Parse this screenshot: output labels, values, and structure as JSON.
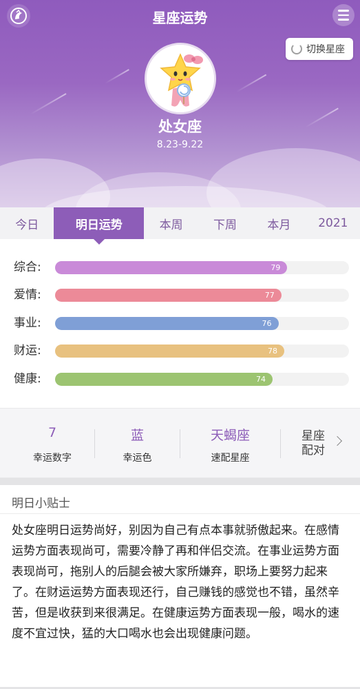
{
  "header": {
    "title": "星座运势",
    "switch_label": "切换星座"
  },
  "sign": {
    "name": "处女座",
    "dates": "8.23-9.22"
  },
  "tabs": [
    {
      "label": "今日",
      "active": false
    },
    {
      "label": "明日运势",
      "active": true
    },
    {
      "label": "本周",
      "active": false
    },
    {
      "label": "下周",
      "active": false
    },
    {
      "label": "本月",
      "active": false
    },
    {
      "label": "2021",
      "active": false
    }
  ],
  "scores": [
    {
      "label": "综合:",
      "value": 79,
      "color": "#c98ad8"
    },
    {
      "label": "爱情:",
      "value": 77,
      "color": "#ec8a98"
    },
    {
      "label": "事业:",
      "value": 76,
      "color": "#7f9fd6"
    },
    {
      "label": "财运:",
      "value": 78,
      "color": "#e8c17f"
    },
    {
      "label": "健康:",
      "value": 74,
      "color": "#9cc471"
    }
  ],
  "lucky": {
    "number": {
      "value": "7",
      "label": "幸运数字"
    },
    "color": {
      "value": "蓝",
      "label": "幸运色"
    },
    "match": {
      "value": "天蝎座",
      "label": "速配星座"
    },
    "pairing_link": "星座配对"
  },
  "tips": {
    "title": "明日小贴士",
    "body": "处女座明日运势尚好，别因为自己有点本事就骄傲起来。在感情运势方面表现尚可，需要冷静了再和伴侣交流。在事业运势方面表现尚可，拖别人的后腿会被大家所嫌弃，职场上要努力起来了。在财运运势方面表现还行，自己赚钱的感觉也不错，虽然辛苦，但是收获到来很满足。在健康运势方面表现一般，喝水的速度不宜过快，猛的大口喝水也会出现健康问题。"
  },
  "icons": {
    "logo": "virgo-logo-icon",
    "menu": "menu-icon",
    "switch": "refresh-icon",
    "avatar": "virgo-mascot-icon",
    "chevron": "chevron-right-icon"
  }
}
